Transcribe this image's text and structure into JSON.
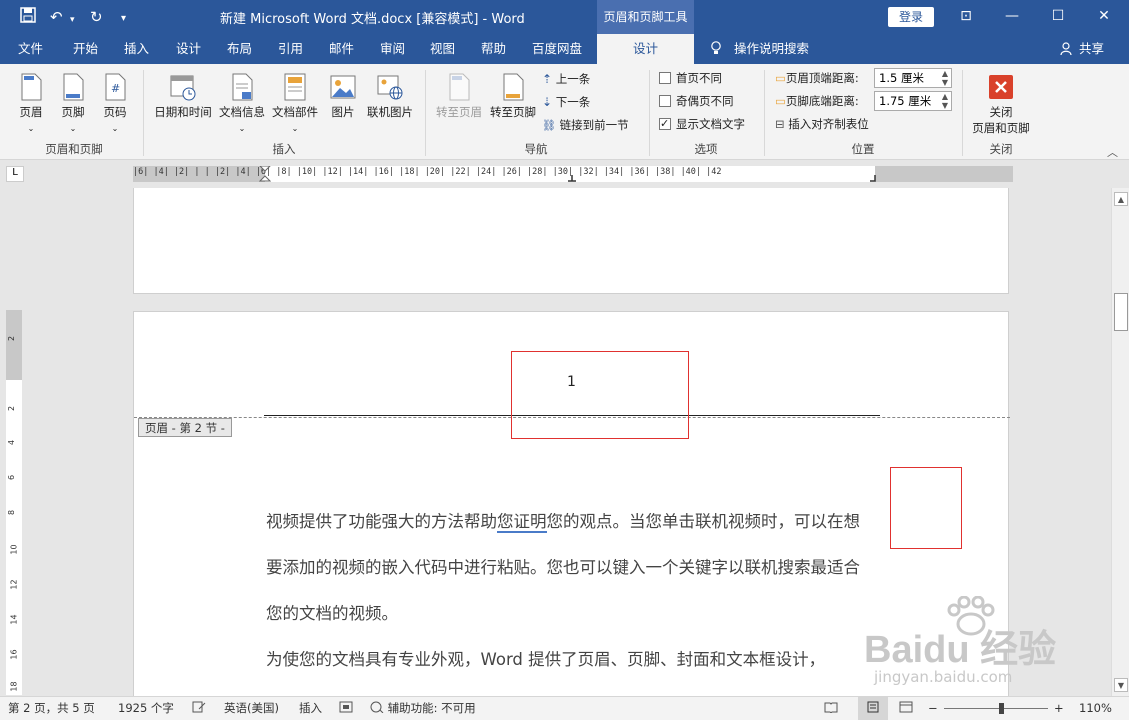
{
  "titlebar": {
    "save_icon": "save-icon",
    "undo_symbol": "↶",
    "redo_symbol": "↻",
    "customize_symbol": "▾",
    "document_title": "新建 Microsoft Word 文档.docx [兼容模式]  -  Word",
    "context_tab": "页眉和页脚工具",
    "login": "登录",
    "ribbon_display_symbol": "⊡",
    "minimize_symbol": "—",
    "maximize_symbol": "☐",
    "close_symbol": "✕"
  },
  "tabs": [
    "文件",
    "开始",
    "插入",
    "设计",
    "布局",
    "引用",
    "邮件",
    "审阅",
    "视图",
    "帮助",
    "百度网盘",
    "设计"
  ],
  "search_tab": "操作说明搜索",
  "share": "共享",
  "ribbon": {
    "header": "页眉",
    "footer": "页脚",
    "page_number": "页码",
    "group_header_footer": "页眉和页脚",
    "date_time": "日期和时间",
    "doc_info": "文档信息",
    "doc_parts": "文档部件",
    "picture": "图片",
    "online_picture": "联机图片",
    "group_insert": "插入",
    "goto_header": "转至页眉",
    "goto_footer": "转至页脚",
    "previous": "上一条",
    "next": "下一条",
    "link_previous": "链接到前一节",
    "group_navigation": "导航",
    "diff_first_page": "首页不同",
    "diff_odd_even": "奇偶页不同",
    "show_doc_text": "显示文档文字",
    "show_doc_text_checked": true,
    "group_options": "选项",
    "header_top_label": "页眉顶端距离:",
    "header_top_value": "1.5 厘米",
    "footer_bottom_label": "页脚底端距离:",
    "footer_bottom_value": "1.75 厘米",
    "insert_align_tab": "插入对齐制表位",
    "group_position": "位置",
    "close_line1": "关闭",
    "close_line2": "页眉和页脚",
    "group_close": "关闭",
    "collapse_symbol": "︿"
  },
  "ruler": {
    "corner": "L",
    "ticks": "|6| |4| |2| | | |2| |4| |6| |8| |10| |12| |14| |16| |18| |20| |22| |24| |26| |28| |30| |32| |34| |36| |38| |40| |42"
  },
  "vruler": {
    "ticks": [
      "2",
      "2",
      "4",
      "6",
      "8",
      "10",
      "12",
      "14",
      "16",
      "18"
    ]
  },
  "document": {
    "header_tag": "页眉 - 第 2 节 -",
    "page_number": "1",
    "para1_part1": "视频提供了功能强大的方法帮助",
    "para1_underlined": "您证明",
    "para1_part2": "您的观点。当您单击联机视频时，可以在想要添加的视频的嵌入代码中进行粘贴。您也可以键入一个关键字以联机搜索最适合您的文档的视频。",
    "para2": "为使您的文档具有专业外观，Word 提供了页眉、页脚、封面和文本框设计，"
  },
  "watermark": {
    "main": "Baidu 经验",
    "sub": "jingyan.baidu.com"
  },
  "statusbar": {
    "page": "第 2 页，共 5 页",
    "words": "1925 个字",
    "language": "英语(美国)",
    "mode": "插入",
    "accessibility": "辅助功能: 不可用",
    "zoom_minus": "−",
    "zoom_plus": "+",
    "zoom": "110%",
    "zoom_level_percent": 110
  }
}
